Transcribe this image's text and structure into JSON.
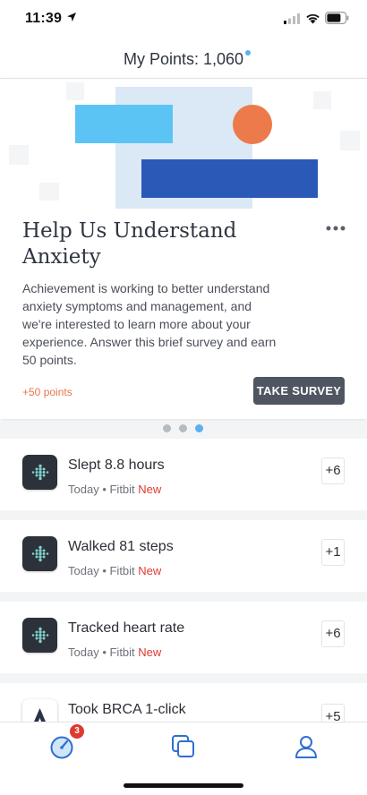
{
  "status_bar": {
    "time": "11:39",
    "icons": [
      "location-arrow-icon",
      "signal-icon",
      "wifi-icon",
      "battery-icon"
    ]
  },
  "header": {
    "title": "My Points: 1,060"
  },
  "survey_card": {
    "title": "Help Us Understand Anxiety",
    "description": "Achievement is working to better understand anxiety symptoms and management, and we're interested to learn more about your experience. Answer this brief survey and earn 50 points.",
    "points_label": "+50 points",
    "button_label": "TAKE SURVEY",
    "colors": {
      "accent": "#e8764a",
      "button": "#4f5661",
      "blue_light": "#5bc4f5",
      "blue_dark": "#2a59b8",
      "orange": "#ec7a4a"
    }
  },
  "pager": {
    "count": 3,
    "active_index": 2
  },
  "activities": [
    {
      "title": "Slept 8.8 hours",
      "date": "Today",
      "source": "Fitbit",
      "badge": "New",
      "points": "+6",
      "icon": "fitbit-icon"
    },
    {
      "title": "Walked 81 steps",
      "date": "Today",
      "source": "Fitbit",
      "badge": "New",
      "points": "+1",
      "icon": "fitbit-icon"
    },
    {
      "title": "Tracked heart rate",
      "date": "Today",
      "source": "Fitbit",
      "badge": "New",
      "points": "+6",
      "icon": "fitbit-icon"
    },
    {
      "title": "Took BRCA 1-click",
      "date": "",
      "source": "",
      "badge": "",
      "points": "+5",
      "icon": "brca-logo-icon"
    }
  ],
  "meta_separator": " • ",
  "tab_bar": {
    "tabs": [
      {
        "name": "activity",
        "icon": "gauge-icon",
        "badge": "3"
      },
      {
        "name": "studies",
        "icon": "stacked-squares-icon"
      },
      {
        "name": "profile",
        "icon": "person-icon"
      }
    ]
  }
}
